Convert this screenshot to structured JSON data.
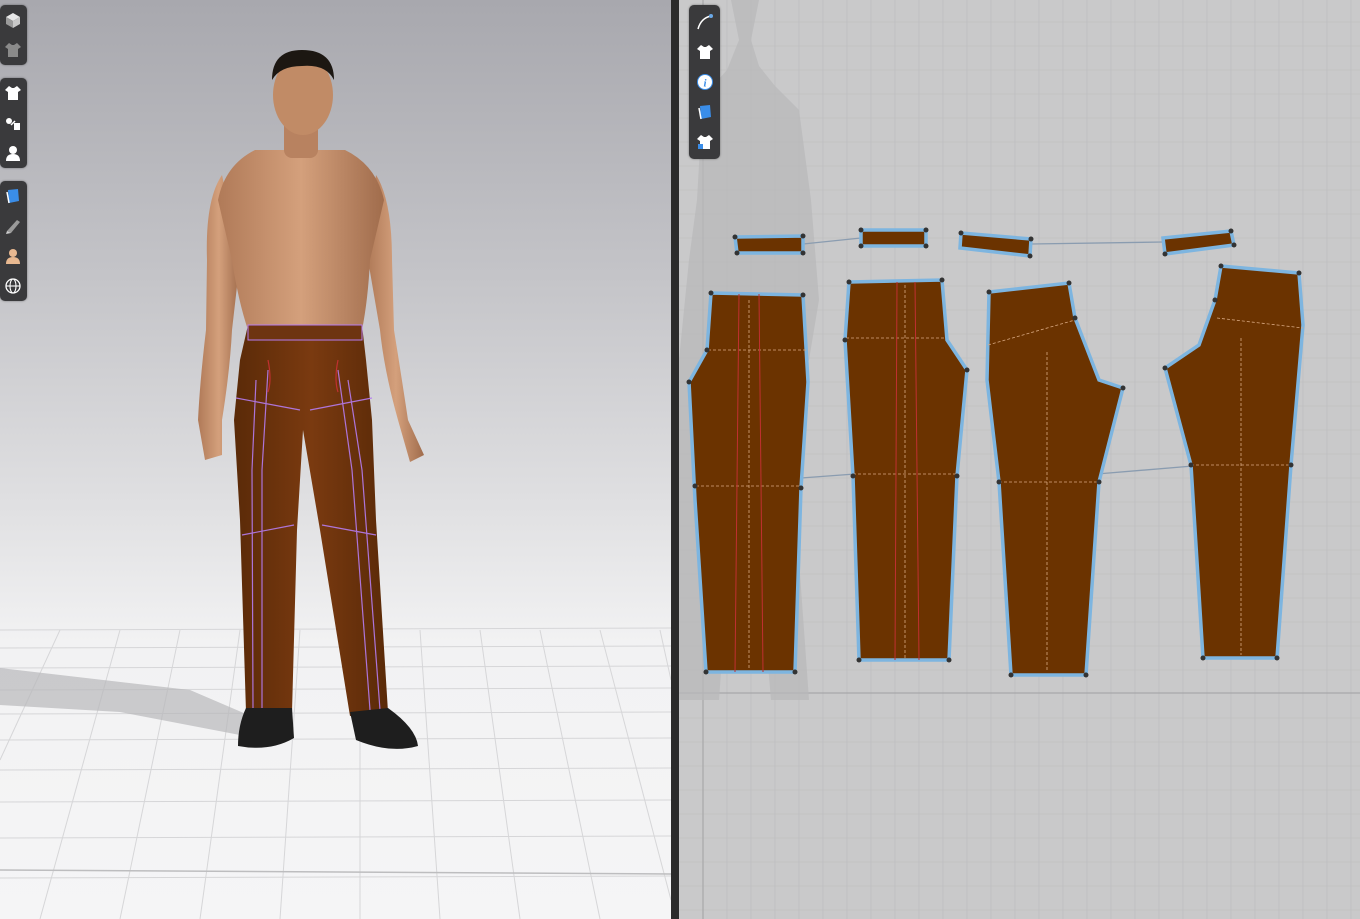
{
  "app": {
    "layout": "3d-and-2d-split-view"
  },
  "viewport_3d": {
    "toolbar_groups": [
      {
        "items": [
          "3d-view-icon",
          "garment-simulate-icon"
        ]
      },
      {
        "items": [
          "show-garment-icon",
          "show-arrangement-icon",
          "show-avatar-icon"
        ]
      },
      {
        "items": [
          "texture-icon",
          "fabric-render-icon",
          "skin-icon",
          "environment-globe-icon"
        ]
      }
    ],
    "avatar": {
      "pose": "A-pose",
      "garment": "pants",
      "shoes": "black"
    }
  },
  "viewport_2d": {
    "toolbar_items": [
      "segment-line-icon",
      "show-garment-2d-icon",
      "info-icon",
      "texture-2d-icon",
      "lock-garment-icon"
    ],
    "pattern_pieces": [
      "waistband-1",
      "waistband-2",
      "waistband-3",
      "waistband-4",
      "front-left",
      "front-right",
      "back-left",
      "back-right"
    ]
  },
  "colors": {
    "fabric": "#6b3300",
    "pattern_outline": "#7db5e0",
    "seam_line": "#8a9cb0",
    "internal_line": "#b57cf0",
    "toolbar_bg": "#3a3a3c"
  }
}
